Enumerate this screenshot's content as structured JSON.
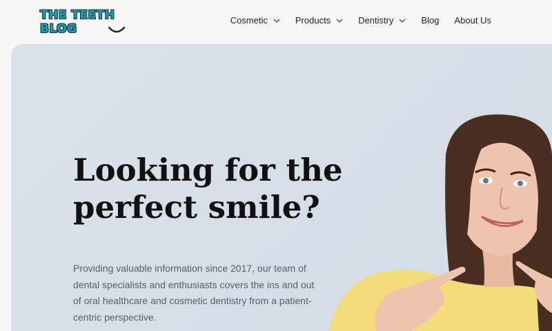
{
  "logo": {
    "text": "THE TEETH BLOG"
  },
  "nav": [
    {
      "label": "Cosmetic",
      "dropdown": true
    },
    {
      "label": "Products",
      "dropdown": true
    },
    {
      "label": "Dentistry",
      "dropdown": true
    },
    {
      "label": "Blog",
      "dropdown": false
    },
    {
      "label": "About Us",
      "dropdown": false
    }
  ],
  "hero": {
    "headline_line1": "Looking for the",
    "headline_line2": "perfect smile?",
    "description": "Providing valuable information since 2017, our team of dental specialists and enthusiasts covers the ins and out of oral healthcare and cosmetic dentistry from a patient-centric perspective."
  },
  "colors": {
    "logo_fill": "#16a2b8",
    "logo_outline": "#1b2b33",
    "hero_bg": "#d6dfe8",
    "sweater": "#f3dc7a",
    "hair": "#4a2e22"
  }
}
